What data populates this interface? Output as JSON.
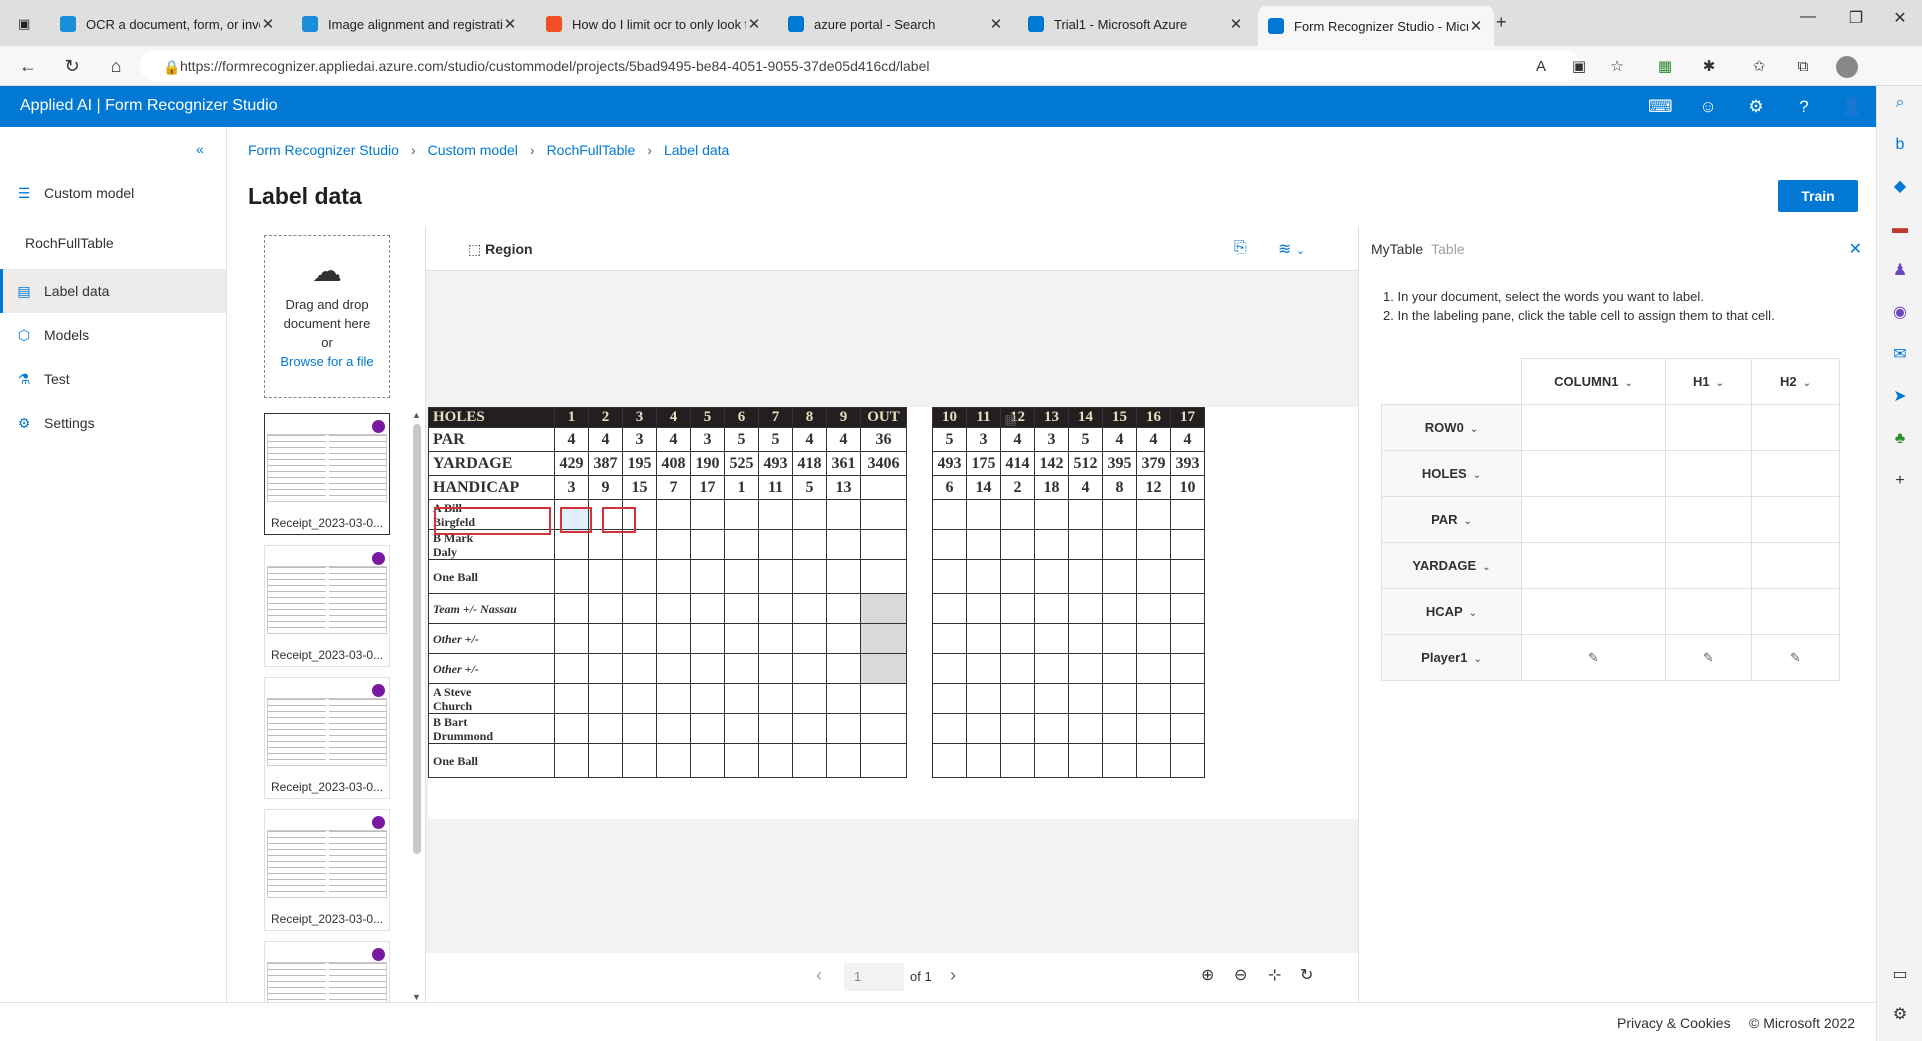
{
  "browser": {
    "tabs": [
      {
        "title": "OCR a document, form, or invoic",
        "icon": "ocr-icon",
        "color": "#1a8fd9"
      },
      {
        "title": "Image alignment and registratio",
        "icon": "doc-icon",
        "color": "#1a8fd9"
      },
      {
        "title": "How do I limit ocr to only look fo",
        "icon": "microsoft-icon",
        "color": "#f25022"
      },
      {
        "title": "azure portal - Search",
        "icon": "search-icon",
        "color": "#0078d4"
      },
      {
        "title": "Trial1 - Microsoft Azure",
        "icon": "azure-icon",
        "color": "#0078d4"
      },
      {
        "title": "Form Recognizer Studio - Micros",
        "icon": "form-icon",
        "color": "#0078d4"
      }
    ],
    "url": "https://formrecognizer.appliedai.azure.com/studio/custommodel/projects/5bad9495-be84-4051-9055-37de05d416cd/label"
  },
  "app": {
    "title": "Applied AI | Form Recognizer Studio"
  },
  "nav": {
    "section": "Custom model",
    "project": "RochFullTable",
    "items": [
      {
        "label": "Label data"
      },
      {
        "label": "Models"
      },
      {
        "label": "Test"
      },
      {
        "label": "Settings"
      }
    ]
  },
  "breadcrumb": [
    "Form Recognizer Studio",
    "Custom model",
    "RochFullTable",
    "Label data"
  ],
  "page": {
    "title": "Label data",
    "train_label": "Train"
  },
  "upload": {
    "line1": "Drag and drop",
    "line2": "document here",
    "line3": "or",
    "browse": "Browse for a file"
  },
  "thumbnails": [
    {
      "name": "Receipt_2023-03-0..."
    },
    {
      "name": "Receipt_2023-03-0..."
    },
    {
      "name": "Receipt_2023-03-0..."
    },
    {
      "name": "Receipt_2023-03-0..."
    }
  ],
  "viewer": {
    "region_label": "Region",
    "page_value": "1",
    "page_of": "of 1"
  },
  "scorecard": {
    "header": [
      "HOLES",
      "1",
      "2",
      "3",
      "4",
      "5",
      "6",
      "7",
      "8",
      "9",
      "OUT",
      "",
      "10",
      "11",
      "12",
      "13",
      "14",
      "15",
      "16",
      "17"
    ],
    "rows": [
      [
        "PAR",
        "4",
        "4",
        "3",
        "4",
        "3",
        "5",
        "5",
        "4",
        "4",
        "36",
        "",
        "5",
        "3",
        "4",
        "3",
        "5",
        "4",
        "4",
        "4"
      ],
      [
        "YARDAGE",
        "429",
        "387",
        "195",
        "408",
        "190",
        "525",
        "493",
        "418",
        "361",
        "3406",
        "",
        "493",
        "175",
        "414",
        "142",
        "512",
        "395",
        "379",
        "393"
      ],
      [
        "HANDICAP",
        "3",
        "9",
        "15",
        "7",
        "17",
        "1",
        "11",
        "5",
        "13",
        "",
        "",
        "6",
        "14",
        "2",
        "18",
        "4",
        "8",
        "12",
        "10"
      ]
    ],
    "players": [
      {
        "label": "A  Bill\nBirgfeld"
      },
      {
        "label": "B  Mark\nDaly"
      },
      {
        "label": "One Ball"
      },
      {
        "label": "Team +/- Nassau"
      },
      {
        "label": "Other +/-"
      },
      {
        "label": "Other +/-"
      },
      {
        "label": "A  Steve\nChurch"
      },
      {
        "label": "B  Bart\nDrummond"
      },
      {
        "label": "One Ball"
      }
    ]
  },
  "table_panel": {
    "name": "MyTable",
    "type": "Table",
    "instructions": [
      "1. In your document, select the words you want to label.",
      "2. In the labeling pane, click the table cell to assign them to that cell."
    ],
    "columns": [
      "COLUMN1",
      "H1",
      "H2"
    ],
    "rows": [
      "ROW0",
      "HOLES",
      "PAR",
      "YARDAGE",
      "HCAP",
      "Player1"
    ]
  },
  "footer": {
    "privacy": "Privacy & Cookies",
    "copyright": "© Microsoft 2022"
  },
  "colors": {
    "accent": "#0078d4",
    "label_dot": "#7a18a2"
  }
}
